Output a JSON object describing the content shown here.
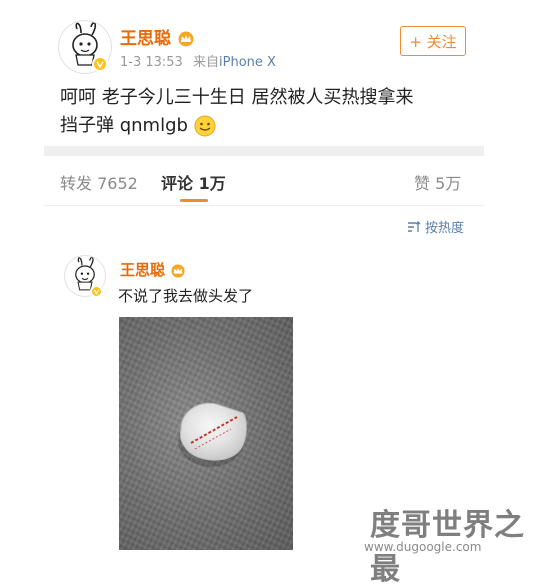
{
  "post": {
    "author": "王思聪",
    "time": "1-3 13:53",
    "source_prefix": "来自",
    "source_device": "iPhone X",
    "follow_label": "+ 关注",
    "text_line1": "呵呵 老子今儿三十生日 居然被人买热搜拿来",
    "text_line2": "挡子弹 qnmlgb"
  },
  "tabs": {
    "repost": "转发 7652",
    "comment": "评论 1万",
    "like": "赞 5万"
  },
  "sort": {
    "label": "按热度",
    "icon": "sort-icon"
  },
  "comment": {
    "author": "王思聪",
    "text": "不说了我去做头发了"
  },
  "watermark": {
    "main": "度哥世界之最",
    "url": "www.dugoogle.com"
  },
  "colors": {
    "name": "#e86b0a",
    "accent": "#f08a33",
    "link": "#5b7ea8",
    "muted": "#9a9a9a"
  }
}
